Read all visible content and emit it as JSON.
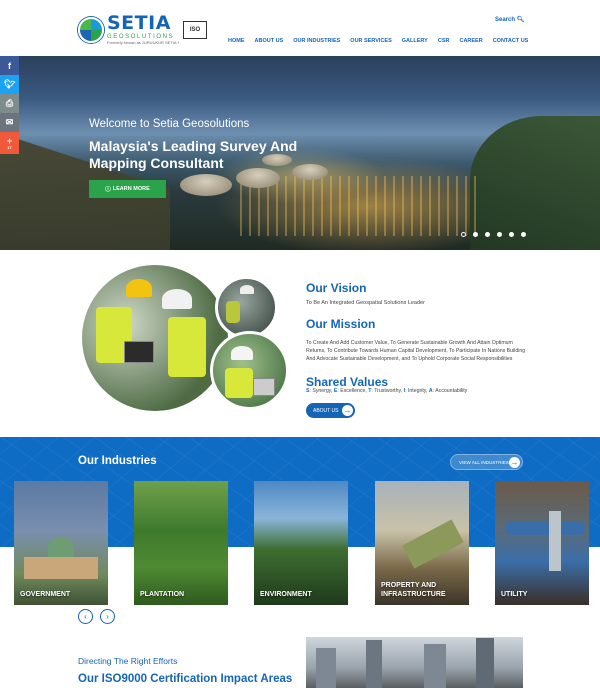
{
  "header": {
    "logo_word": "SETIA",
    "logo_sub": "GEOSOLUTIONS",
    "logo_tag": "Formerly known as JURUUKUR SETIA SDN BHD",
    "cert_label": "ISO",
    "search_label": "Search",
    "nav": [
      "HOME",
      "ABOUT US",
      "OUR INDUSTRIES",
      "OUR SERVICES",
      "GALLERY",
      "CSR",
      "CAREER",
      "CONTACT US"
    ]
  },
  "social": {
    "facebook": "f",
    "twitter": "t",
    "print": "p",
    "email": "e",
    "plus": "+",
    "plus_count": "17"
  },
  "hero": {
    "welcome": "Welcome to Setia Geosolutions",
    "title": "Malaysia's Leading Survey And Mapping Consultant",
    "button_label": "LEARN MORE",
    "slide_count": 6,
    "active_slide": 1
  },
  "about": {
    "vision_heading": "Our Vision",
    "vision_text": "To Be An Integrated Geospatial Solutions Leader",
    "mission_heading": "Our Mission",
    "mission_text": "To Create And Add Customer Value, To Generate Sustainable Growth And Attain Optimum Returns, To Contribute Towards Human Capital Development, To Participate In Nations Building And Advocate Sustainable Development, and To Uphold Corporate Social Responsibilities",
    "values_heading": "Shared Values",
    "values": [
      {
        "letter": "S",
        "text": "Synergy, "
      },
      {
        "letter": "E",
        "text": "Excellence, "
      },
      {
        "letter": "T",
        "text": "Trustworthy, "
      },
      {
        "letter": "I",
        "text": "Integrity, "
      },
      {
        "letter": "A",
        "text": "Accountability"
      }
    ],
    "button_label": "ABOUT US"
  },
  "industries": {
    "heading": "Our Industries",
    "view_all_label": "VIEW ALL INDUSTRIES",
    "cards": [
      "GOVERNMENT",
      "PLANTATION",
      "ENVIRONMENT",
      "PROPERTY AND INFRASTRUCTURE",
      "UTILITY"
    ],
    "prev": "‹",
    "next": "›"
  },
  "iso": {
    "subheading": "Directing The Right Efforts",
    "heading": "Our ISO9000 Certification Impact Areas"
  },
  "colors": {
    "brand_blue": "#1565b7",
    "brand_green": "#2aa34a",
    "industries_band": "#0f6cc4"
  }
}
